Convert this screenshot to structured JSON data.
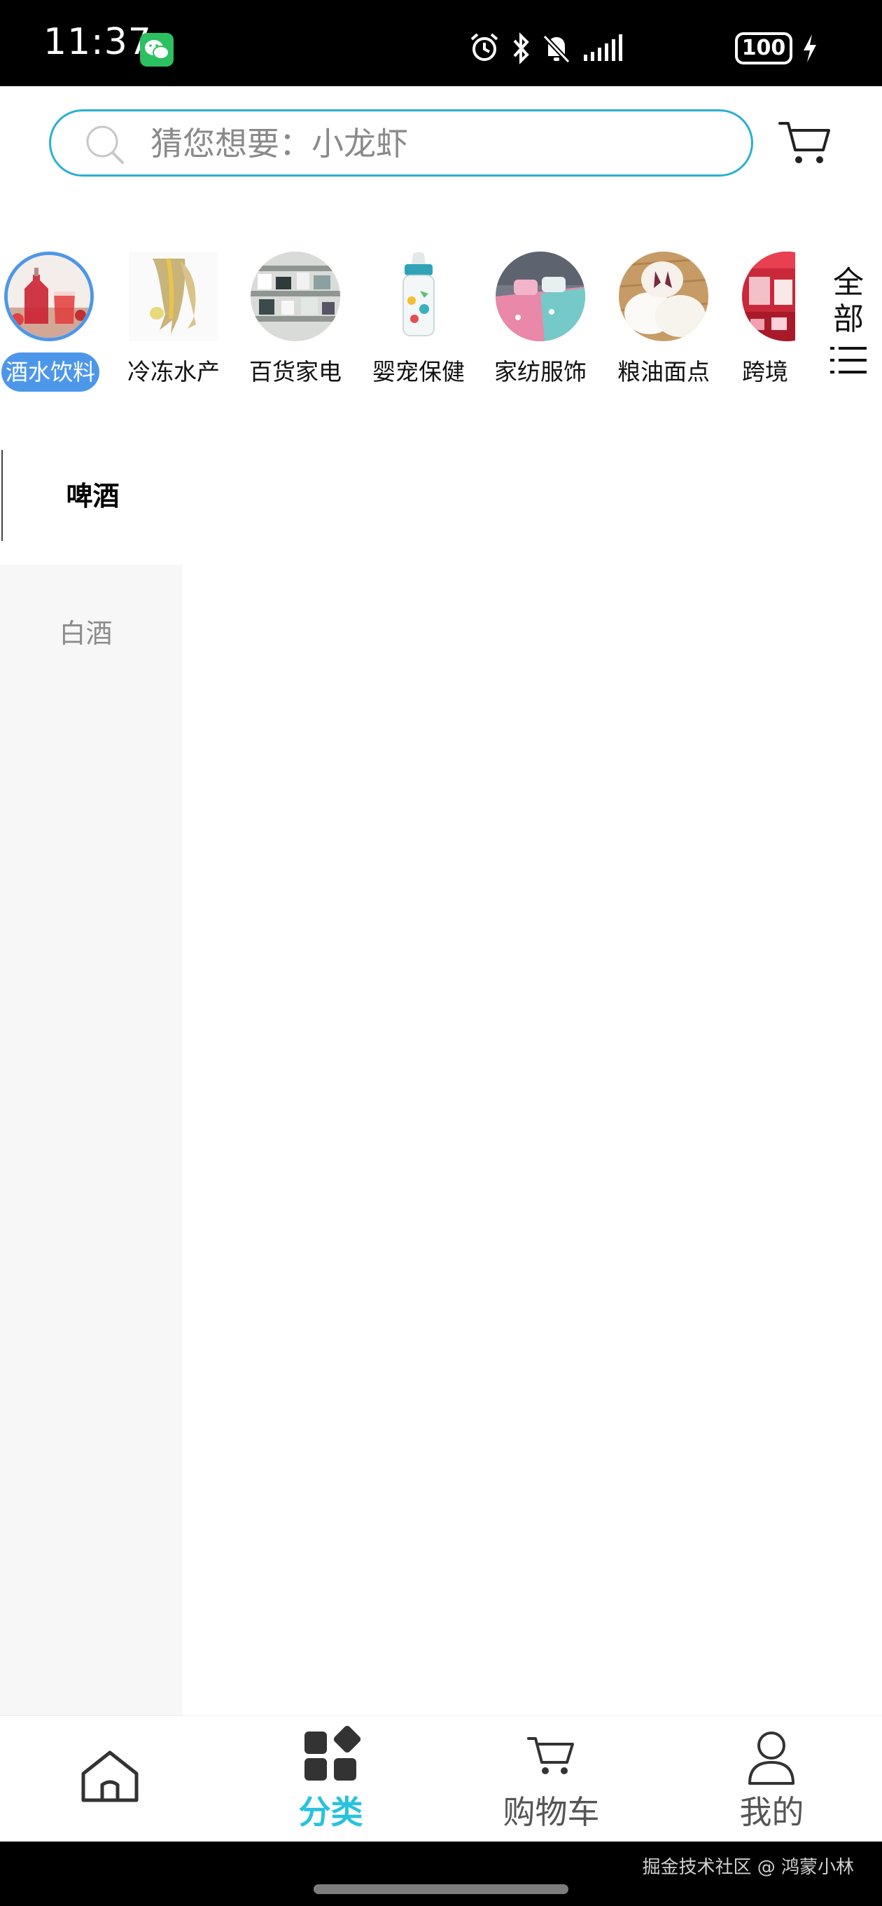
{
  "status_bar": {
    "time": "11:37",
    "battery": "100",
    "icons": [
      "wechat-icon",
      "alarm-icon",
      "bluetooth-icon",
      "mute-icon",
      "signal-icon",
      "battery-icon",
      "charging-icon"
    ]
  },
  "search": {
    "placeholder": "猜您想要：小龙虾"
  },
  "categories": [
    {
      "label": "酒水饮料",
      "selected": true,
      "icon": "drinks-image"
    },
    {
      "label": "冷冻水产",
      "selected": false,
      "icon": "fish-image"
    },
    {
      "label": "百货家电",
      "selected": false,
      "icon": "appliances-image"
    },
    {
      "label": "婴宠保健",
      "selected": false,
      "icon": "baby-bottle-image"
    },
    {
      "label": "家纺服饰",
      "selected": false,
      "icon": "bedding-image"
    },
    {
      "label": "粮油面点",
      "selected": false,
      "icon": "pastry-image"
    },
    {
      "label": "跨境",
      "selected": false,
      "icon": "cross-border-image"
    }
  ],
  "all_button": {
    "label": "全部"
  },
  "subcategories": {
    "active": "啤酒",
    "items": [
      "白酒"
    ]
  },
  "tabs": [
    {
      "label": "",
      "icon": "home-icon",
      "active": false
    },
    {
      "label": "分类",
      "icon": "category-icon",
      "active": true
    },
    {
      "label": "购物车",
      "icon": "cart-icon",
      "active": false
    },
    {
      "label": "我的",
      "icon": "user-icon",
      "active": false
    }
  ],
  "watermark": "掘金技术社区 @ 鸿蒙小林",
  "colors": {
    "accent": "#28c2df",
    "selected_category": "#4d97ea",
    "search_border": "#29b0d0"
  }
}
